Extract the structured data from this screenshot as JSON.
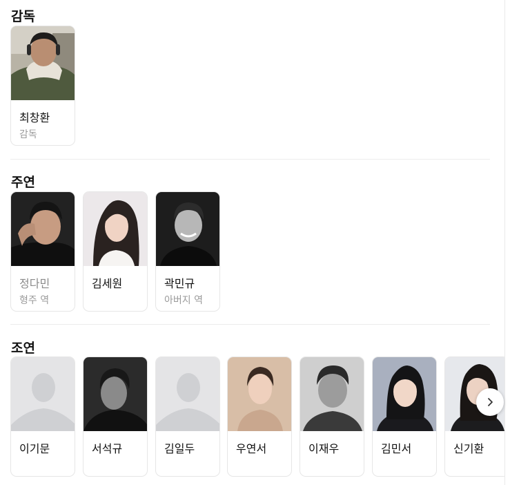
{
  "sections": {
    "director": {
      "title": "감독",
      "people": [
        {
          "name": "최창환",
          "role": "감독"
        }
      ]
    },
    "lead": {
      "title": "주연",
      "people": [
        {
          "name": "정다민",
          "role": "형주 역"
        },
        {
          "name": "김세원",
          "role": ""
        },
        {
          "name": "곽민규",
          "role": "아버지 역"
        }
      ]
    },
    "supporting": {
      "title": "조연",
      "people": [
        {
          "name": "이기문",
          "role": ""
        },
        {
          "name": "서석규",
          "role": ""
        },
        {
          "name": "김일두",
          "role": ""
        },
        {
          "name": "우연서",
          "role": ""
        },
        {
          "name": "이재우",
          "role": ""
        },
        {
          "name": "김민서",
          "role": ""
        },
        {
          "name": "신기환",
          "role": ""
        }
      ]
    }
  },
  "icons": {
    "placeholder_avatar": "person-silhouette-icon",
    "next": "chevron-right-icon"
  },
  "colors": {
    "placeholder_bg": "#e4e4e6",
    "placeholder_fg": "#cfd0d3",
    "card_border": "#e6e6e6",
    "muted_text": "#9a9a9a"
  }
}
